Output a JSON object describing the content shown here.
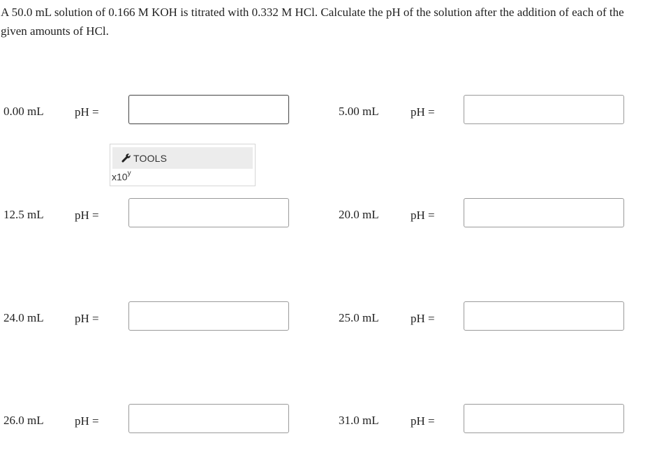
{
  "question": {
    "text": "A 50.0 mL solution of 0.166 M KOH is titrated with 0.332 M HCl. Calculate the pH of the solution after the addition of each of the given amounts of HCl."
  },
  "ph_label": "pH =",
  "rows": [
    {
      "left": {
        "volume": "0.00 mL",
        "value": ""
      },
      "right": {
        "volume": "5.00 mL",
        "value": ""
      }
    },
    {
      "left": {
        "volume": "12.5 mL",
        "value": ""
      },
      "right": {
        "volume": "20.0 mL",
        "value": ""
      }
    },
    {
      "left": {
        "volume": "24.0 mL",
        "value": ""
      },
      "right": {
        "volume": "25.0 mL",
        "value": ""
      }
    },
    {
      "left": {
        "volume": "26.0 mL",
        "value": ""
      },
      "right": {
        "volume": "31.0 mL",
        "value": ""
      }
    }
  ],
  "tools": {
    "label": "TOOLS",
    "icon": "wrench-icon",
    "sci_base": "x10",
    "sci_exp": "y"
  }
}
